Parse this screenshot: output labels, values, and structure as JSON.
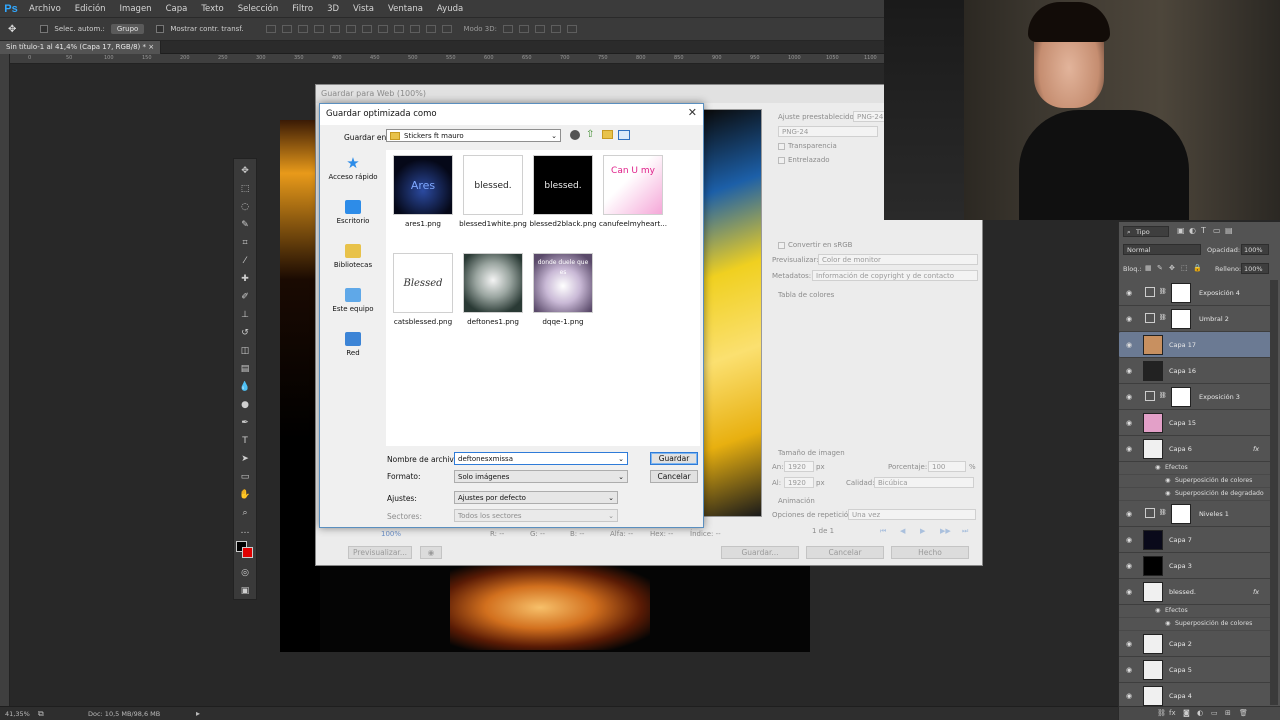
{
  "app": {
    "logo": "Ps"
  },
  "menu": [
    "Archivo",
    "Edición",
    "Imagen",
    "Capa",
    "Texto",
    "Selección",
    "Filtro",
    "3D",
    "Vista",
    "Ventana",
    "Ayuda"
  ],
  "options": {
    "auto_select": "Selec. autom.:",
    "auto_select_value": "Grupo",
    "show_transform": "Mostrar contr. transf.",
    "mode_3d": "Modo 3D:"
  },
  "doc_tab": "Sin título-1 al 41,4% (Capa 17, RGB/8) *",
  "ruler_ticks": [
    "0",
    "50",
    "100",
    "150",
    "200",
    "250",
    "300",
    "350",
    "400",
    "450",
    "500",
    "550",
    "600",
    "650",
    "700",
    "750",
    "800",
    "850",
    "900",
    "950",
    "1000",
    "1050",
    "1100",
    "1150",
    "1200",
    "1250",
    "1300",
    "1350"
  ],
  "status": {
    "zoom": "41,35%",
    "doc": "Doc: 10,5 MB/98,6 MB"
  },
  "sfw": {
    "title": "Guardar para Web (100%)",
    "preset_label": "Ajuste preestablecido:",
    "preset_value": "PNG-24",
    "format_value": "PNG-24",
    "transparency": "Transparencia",
    "interlaced": "Entrelazado",
    "convert_srgb": "Convertir en sRGB",
    "preview_label": "Previsualizar:",
    "preview_value": "Color de monitor",
    "metadata_label": "Metadatos:",
    "metadata_value": "Información de copyright y de contacto",
    "color_table": "Tabla de colores",
    "image_size": "Tamaño de imagen",
    "width_label": "An:",
    "width_value": "1920",
    "height_label": "Al:",
    "height_value": "1920",
    "px": "px",
    "percent_label": "Porcentaje:",
    "percent_value": "100",
    "percent_unit": "%",
    "quality_label": "Calidad:",
    "quality_value": "Bicúbica",
    "animation": "Animación",
    "loop_label": "Opciones de repetición:",
    "loop_value": "Una vez",
    "frames": "1 de 1",
    "zoom_value": "100%",
    "r": "R: --",
    "g": "G: --",
    "b": "B: --",
    "alpha": "Alfa: --",
    "hex": "Hex: --",
    "index": "Índice: --",
    "btn_preview": "Previsualizar...",
    "btn_save": "Guardar...",
    "btn_cancel": "Cancelar",
    "btn_done": "Hecho"
  },
  "dialog": {
    "title": "Guardar optimizada como",
    "save_in_label": "Guardar en:",
    "save_in_value": "Stickers ft mauro",
    "places": [
      "Acceso rápido",
      "Escritorio",
      "Bibliotecas",
      "Este equipo",
      "Red"
    ],
    "files": [
      {
        "name": "ares1.png",
        "text": "Ares"
      },
      {
        "name": "blessed1white.png",
        "text": "blessed."
      },
      {
        "name": "blessed2black.png",
        "text": "blessed."
      },
      {
        "name": "canufeelmyheart...",
        "text": "Can U my"
      },
      {
        "name": "catsblessed.png",
        "text": "Blessed"
      },
      {
        "name": "deftones1.png",
        "text": ""
      },
      {
        "name": "dqqe-1.png",
        "text": "donde duele que es"
      }
    ],
    "filename_label": "Nombre de archivo:",
    "filename_value": "deftonesxmissa",
    "format_label": "Formato:",
    "format_value": "Solo imágenes",
    "settings_label": "Ajustes:",
    "settings_value": "Ajustes por defecto",
    "slices_label": "Sectores:",
    "slices_value": "Todos los sectores",
    "save_button": "Guardar",
    "cancel_button": "Cancelar",
    "close": "✕"
  },
  "layers": {
    "filter": "Tipo",
    "blend": "Normal",
    "opacity_label": "Opacidad:",
    "opacity_value": "100%",
    "lock_label": "Bloq.:",
    "fill_label": "Relleno:",
    "fill_value": "100%",
    "effects": "Efectos",
    "rows": [
      {
        "name": "Exposición 4",
        "type": "adj"
      },
      {
        "name": "Umbral 2",
        "type": "adj"
      },
      {
        "name": "Capa 17",
        "type": "img",
        "selected": true
      },
      {
        "name": "Capa 16",
        "type": "img"
      },
      {
        "name": "Exposición 3",
        "type": "adj"
      },
      {
        "name": "Capa 15",
        "type": "img"
      },
      {
        "name": "Capa 6",
        "type": "fx"
      },
      {
        "name": "Superposición de colores",
        "type": "sub"
      },
      {
        "name": "Superposición de degradado",
        "type": "sub"
      },
      {
        "name": "Niveles 1",
        "type": "adj"
      },
      {
        "name": "Capa 7",
        "type": "img"
      },
      {
        "name": "Capa 3",
        "type": "img"
      },
      {
        "name": "blessed.",
        "type": "fx"
      },
      {
        "name": "Superposición de colores",
        "type": "sub"
      },
      {
        "name": "Capa 2",
        "type": "img"
      },
      {
        "name": "Capa 5",
        "type": "img"
      },
      {
        "name": "Capa 4",
        "type": "img"
      }
    ]
  },
  "colors": {
    "accent": "#31a8ff",
    "selection": "#6b7a93",
    "primary_border": "#2e7bd8"
  }
}
